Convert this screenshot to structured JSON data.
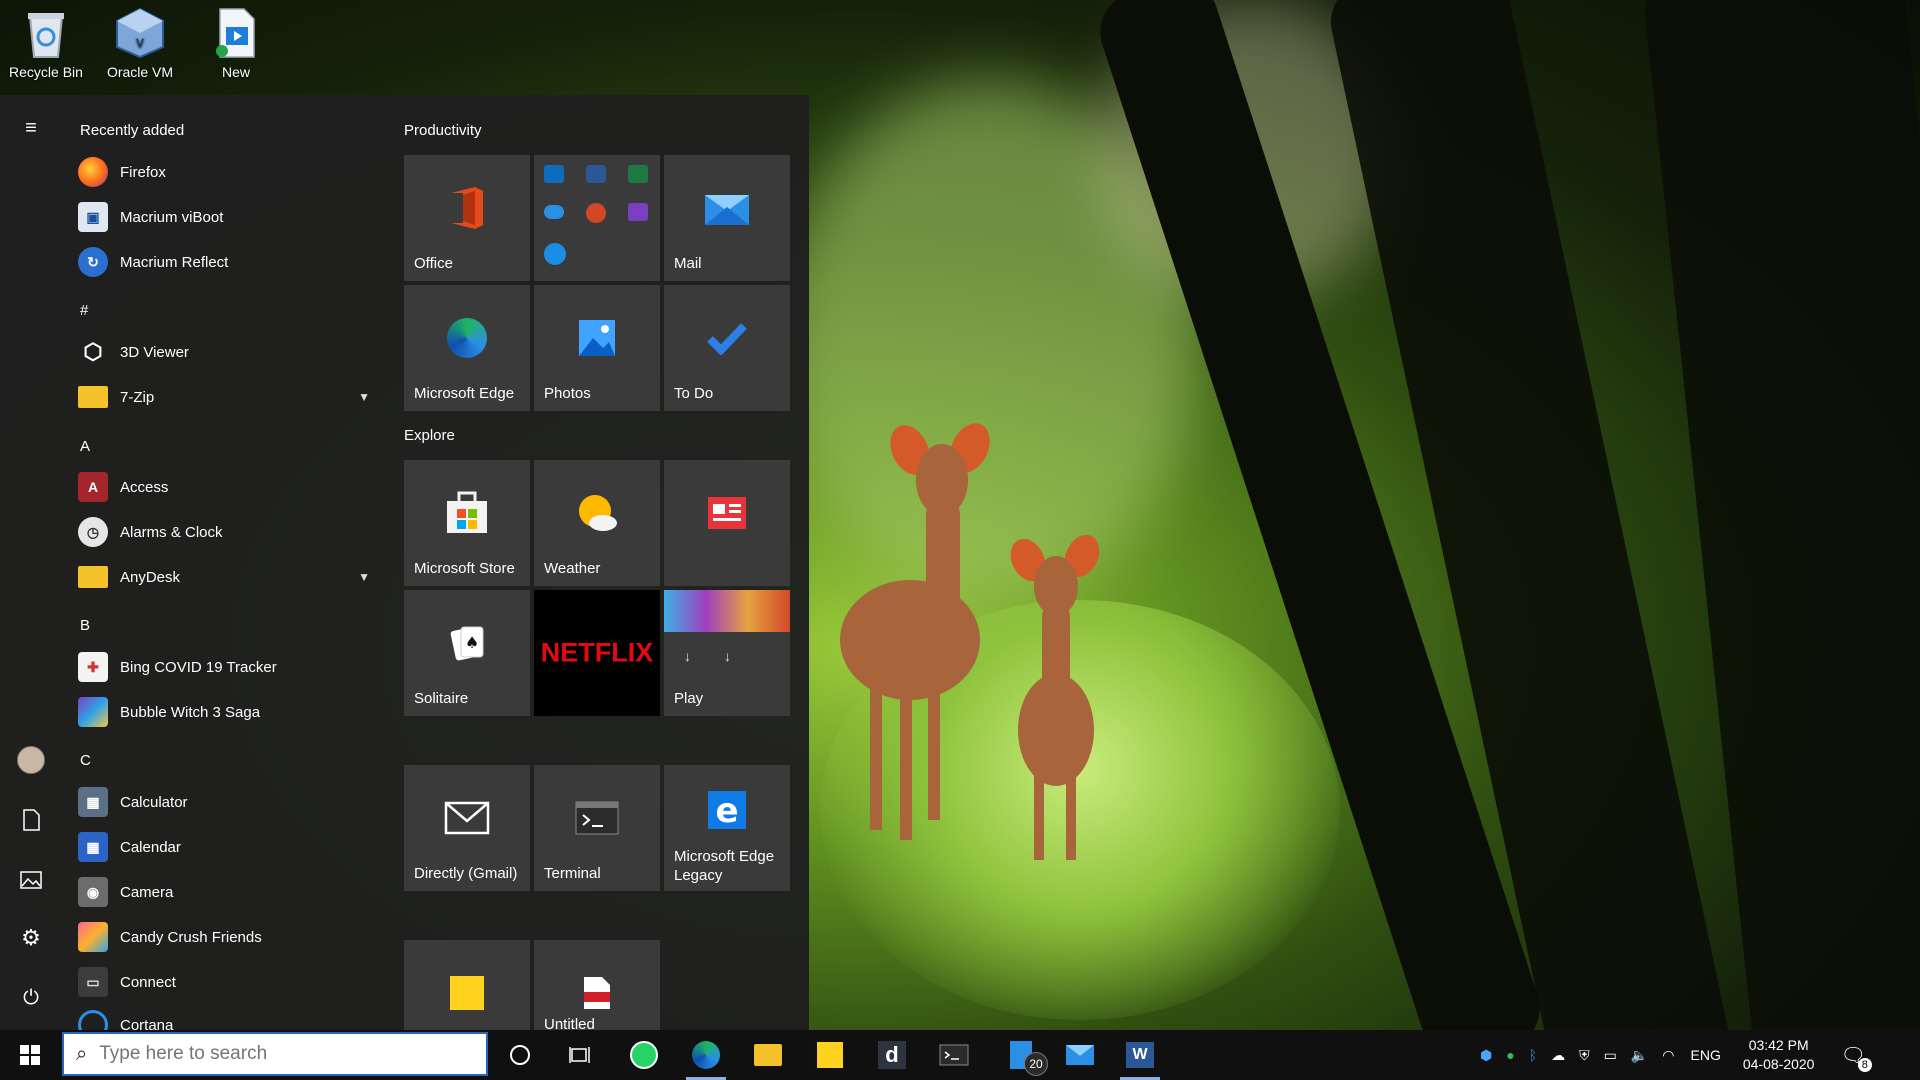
{
  "desktop": {
    "icons": [
      {
        "label": "Recycle Bin"
      },
      {
        "label": "Oracle VM"
      },
      {
        "label": "New"
      }
    ]
  },
  "start_menu": {
    "apps": {
      "sections": {
        "recent": "Recently added",
        "hash": "#",
        "a": "A",
        "b": "B",
        "c": "C"
      },
      "items": [
        {
          "label": "Firefox",
          "icon": "firefox-icon"
        },
        {
          "label": "Macrium viBoot",
          "icon": "macrium-viboot-icon"
        },
        {
          "label": "Macrium Reflect",
          "icon": "macrium-reflect-icon"
        },
        {
          "label": "3D Viewer",
          "icon": "cube-icon"
        },
        {
          "label": "7-Zip",
          "icon": "folder-icon"
        },
        {
          "label": "Access",
          "icon": "access-icon"
        },
        {
          "label": "Alarms & Clock",
          "icon": "clock-icon"
        },
        {
          "label": "AnyDesk",
          "icon": "folder-icon"
        },
        {
          "label": "Bing COVID 19 Tracker",
          "icon": "tracker-icon"
        },
        {
          "label": "Bubble Witch 3 Saga",
          "icon": "game-icon"
        },
        {
          "label": "Calculator",
          "icon": "calculator-icon"
        },
        {
          "label": "Calendar",
          "icon": "calendar-icon"
        },
        {
          "label": "Camera",
          "icon": "camera-icon"
        },
        {
          "label": "Candy Crush Friends",
          "icon": "game-icon"
        },
        {
          "label": "Connect",
          "icon": "connect-icon"
        },
        {
          "label": "Cortana",
          "icon": "cortana-icon"
        }
      ]
    },
    "tiles": {
      "groups": {
        "productivity": "Productivity",
        "explore": "Explore"
      },
      "items": {
        "office": "Office",
        "mail": "Mail",
        "edge": "Microsoft Edge",
        "photos": "Photos",
        "todo": "To Do",
        "store": "Microsoft Store",
        "weather": "Weather",
        "solitaire": "Solitaire",
        "netflix": "NETFLIX",
        "play": "Play",
        "gmail": "Directly (Gmail)",
        "terminal": "Terminal",
        "edge_legacy_1": "Microsoft Edge",
        "edge_legacy_2": "Legacy",
        "untitled": "Untitled"
      }
    }
  },
  "taskbar": {
    "search_placeholder": "Type here to search",
    "badge_files": "20",
    "tray": {
      "language": "ENG",
      "time": "03:42 PM",
      "date": "04-08-2020",
      "notifications": "8"
    }
  },
  "colors": {
    "accent": "#2b64c4",
    "start_bg": "#1f1f1f",
    "tile_bg": "#3a3a3a"
  }
}
